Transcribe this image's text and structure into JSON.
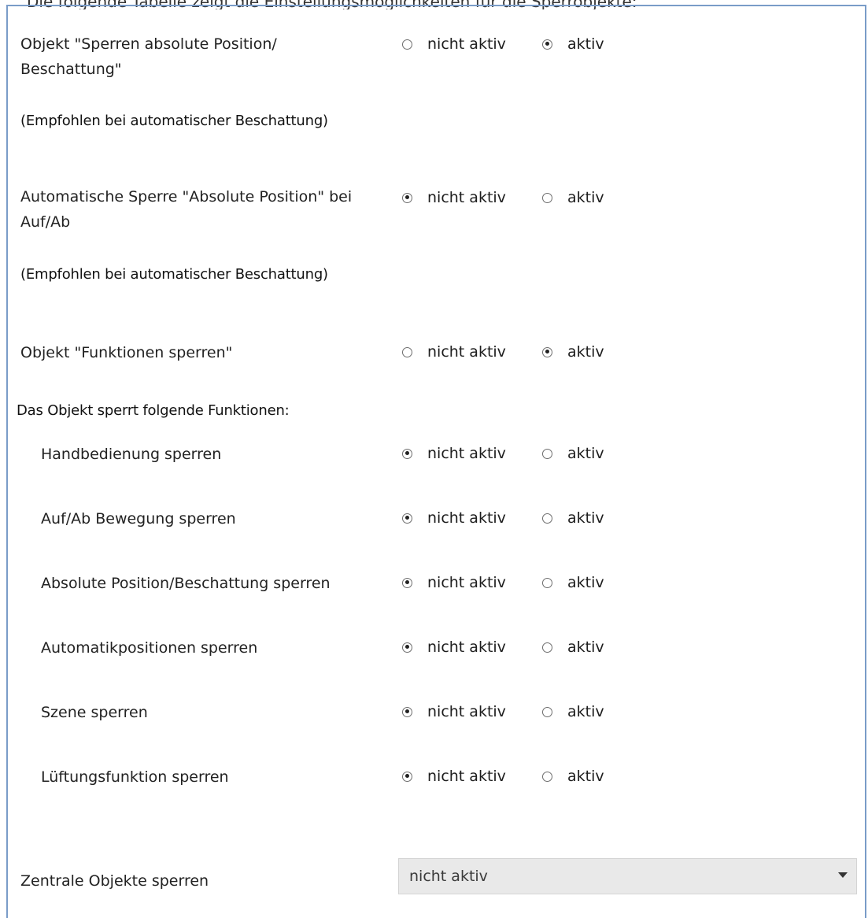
{
  "top_cut_text": "Die folgende Tabelle zeigt die Einstellungsmöglichkeiten für die Sperrobjekte:",
  "settings": {
    "object_lock_position": {
      "label_line1": "Objekt \"Sperren absolute Position/",
      "label_line2": "Beschattung\"",
      "selected": "aktiv"
    },
    "note1": "(Empfohlen bei automatischer Beschattung)",
    "auto_lock_absolute": {
      "label_line1": "Automatische Sperre \"Absolute Position\" bei",
      "label_line2": "Auf/Ab",
      "selected": "nicht aktiv"
    },
    "note2": "(Empfohlen bei automatischer Beschattung)",
    "object_lock_functions": {
      "label": "Objekt \"Funktionen sperren\"",
      "selected": "aktiv"
    },
    "lock_section_heading": "Das Objekt sperrt folgende Funktionen:",
    "lock_items": [
      {
        "label": "Handbedienung sperren",
        "selected": "nicht aktiv"
      },
      {
        "label": "Auf/Ab Bewegung sperren",
        "selected": "nicht aktiv"
      },
      {
        "label": "Absolute Position/Beschattung sperren",
        "selected": "nicht aktiv"
      },
      {
        "label": "Automatikpositionen sperren",
        "selected": "nicht aktiv"
      },
      {
        "label": "Szene sperren",
        "selected": "nicht aktiv"
      },
      {
        "label": "Lüftungsfunktion sperren",
        "selected": "nicht aktiv"
      }
    ],
    "central_objects": {
      "label": "Zentrale Objekte sperren",
      "value": "nicht aktiv"
    }
  },
  "options": {
    "inactive": "nicht aktiv",
    "active": "aktiv"
  }
}
